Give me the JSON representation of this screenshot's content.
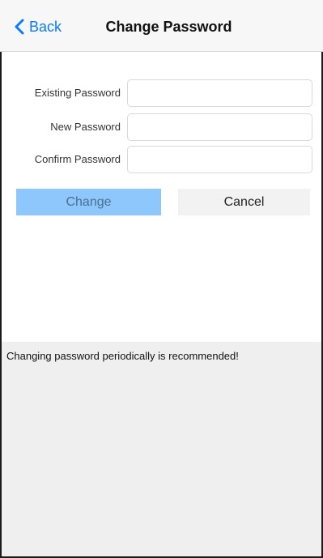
{
  "navbar": {
    "back_label": "Back",
    "title": "Change Password"
  },
  "form": {
    "fields": [
      {
        "label": "Existing Password",
        "value": "",
        "placeholder": ""
      },
      {
        "label": "New Password",
        "value": "",
        "placeholder": ""
      },
      {
        "label": "Confirm Password",
        "value": "",
        "placeholder": ""
      }
    ]
  },
  "actions": {
    "change_label": "Change",
    "cancel_label": "Cancel"
  },
  "footer": {
    "hint": "Changing password periodically is recommended!"
  },
  "colors": {
    "accent": "#0a7aff",
    "change_button_bg": "#8dc7fb",
    "cancel_button_bg": "#f2f2f2",
    "panel_bg": "#efefef"
  }
}
